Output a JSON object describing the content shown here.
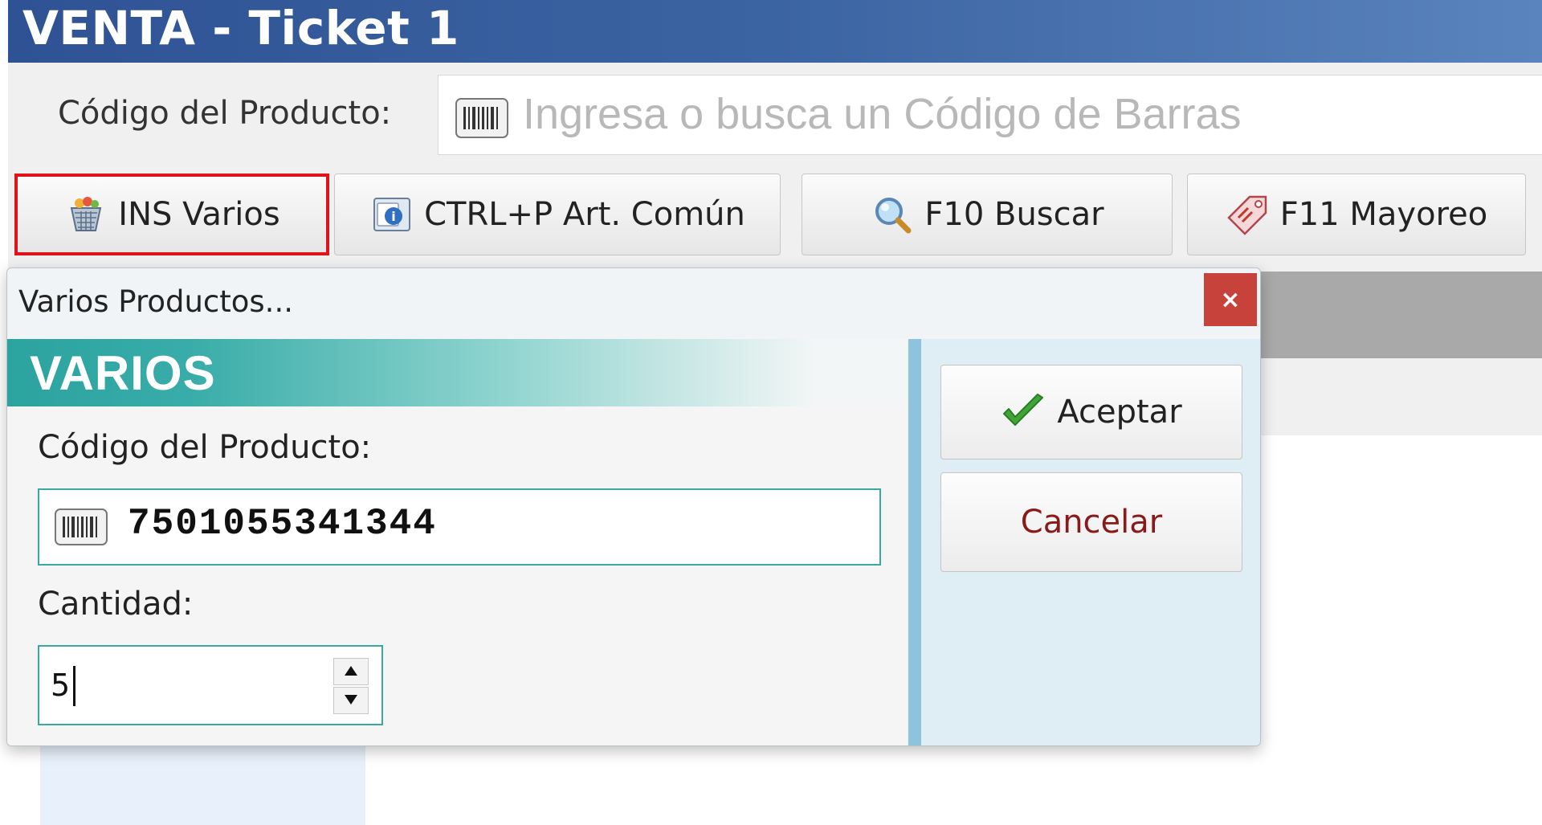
{
  "window": {
    "title": "VENTA - Ticket 1"
  },
  "product_code": {
    "label": "Código del Producto:",
    "placeholder": "Ingresa o busca un Código de Barras"
  },
  "toolbar": {
    "buttons": [
      {
        "label": "INS Varios",
        "icon": "basket-icon",
        "active": true
      },
      {
        "label": "CTRL+P Art. Común",
        "icon": "common-article-icon"
      },
      {
        "label": "F10 Buscar",
        "icon": "magnifier-icon"
      },
      {
        "label": "F11 Mayoreo",
        "icon": "price-tag-icon"
      }
    ]
  },
  "dialog": {
    "title": "Varios Productos...",
    "close_label": "×",
    "header": "VARIOS",
    "code_label": "Código del Producto:",
    "code_value": "7501055341344",
    "qty_label": "Cantidad:",
    "qty_value": "5",
    "accept_label": "Aceptar",
    "cancel_label": "Cancelar"
  },
  "colors": {
    "title_bar": "#2f5294",
    "highlight_border": "#e0131a",
    "teal_accent": "#2ba39f",
    "close_button": "#c8423c",
    "cancel_text": "#8a1a1a",
    "accept_check": "#3fa535"
  }
}
